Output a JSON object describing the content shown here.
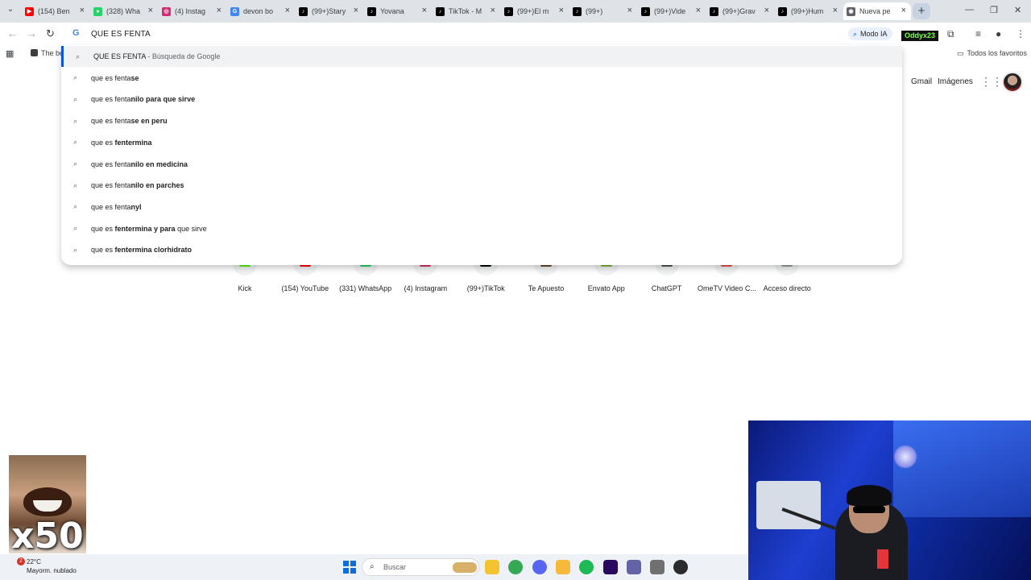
{
  "tabs": [
    {
      "label": "(154) Ben",
      "icon": "youtube-icon",
      "color": "#ff0000",
      "glyph": "▶"
    },
    {
      "label": "(328) Wha",
      "icon": "whatsapp-icon",
      "color": "#25d366",
      "glyph": "●"
    },
    {
      "label": "(4) Instag",
      "icon": "instagram-icon",
      "color": "#d62976",
      "glyph": "◎"
    },
    {
      "label": "devon bo",
      "icon": "google-icon",
      "color": "#4285f4",
      "glyph": "G"
    },
    {
      "label": "(99+)Stary",
      "icon": "tiktok-icon",
      "color": "#000000",
      "glyph": "♪"
    },
    {
      "label": "Yovana",
      "icon": "tiktok-icon",
      "color": "#000000",
      "glyph": "♪"
    },
    {
      "label": "TikTok - M",
      "icon": "tiktok-icon",
      "color": "#000000",
      "glyph": "♪"
    },
    {
      "label": "(99+)El m",
      "icon": "tiktok-icon",
      "color": "#000000",
      "glyph": "♪"
    },
    {
      "label": "(99+)",
      "icon": "tiktok-icon",
      "color": "#000000",
      "glyph": "♪"
    },
    {
      "label": "(99+)Vide",
      "icon": "tiktok-icon",
      "color": "#000000",
      "glyph": "♪"
    },
    {
      "label": "(99+)Grav",
      "icon": "tiktok-icon",
      "color": "#000000",
      "glyph": "♪"
    },
    {
      "label": "(99+)Hum",
      "icon": "tiktok-icon",
      "color": "#000000",
      "glyph": "♪"
    },
    {
      "label": "Nueva pe",
      "icon": "chrome-icon",
      "color": "#5f6368",
      "glyph": "◉",
      "active": true
    }
  ],
  "omnibox": {
    "value": "QUE ES FENTA",
    "modo_ia": "Modo IA",
    "profile_badge": "Oddyx23"
  },
  "bookmarks": {
    "first": "The be",
    "all_favorites": "Todos los favoritos"
  },
  "google_header": {
    "gmail": "Gmail",
    "images": "Imágenes"
  },
  "suggestions": [
    {
      "prefix": "QUE ES FENTA",
      "bold": "",
      "suffix": " - Búsqueda de Google",
      "selected": true
    },
    {
      "prefix": "que es fenta",
      "bold": "se",
      "suffix": ""
    },
    {
      "prefix": "que es fenta",
      "bold": "nilo para que sirve",
      "suffix": ""
    },
    {
      "prefix": "que es fenta",
      "bold": "se en peru",
      "suffix": ""
    },
    {
      "prefix": "que es ",
      "bold": "fentermina",
      "suffix": ""
    },
    {
      "prefix": "que es fenta",
      "bold": "nilo en medicina",
      "suffix": ""
    },
    {
      "prefix": "que es fenta",
      "bold": "nilo en parches",
      "suffix": ""
    },
    {
      "prefix": "que es fenta",
      "bold": "nyl",
      "suffix": ""
    },
    {
      "prefix": "que es ",
      "bold": "fentermina y para",
      "suffix": " que sirve"
    },
    {
      "prefix": "que es ",
      "bold": "fentermina clorhidrato",
      "suffix": ""
    }
  ],
  "shortcuts": [
    {
      "label": "Kick",
      "color": "#53fc18"
    },
    {
      "label": "(154) YouTube",
      "color": "#ff0000"
    },
    {
      "label": "(331) WhatsApp",
      "color": "#25d366"
    },
    {
      "label": "(4) Instagram",
      "color": "#e1306c"
    },
    {
      "label": "(99+)TikTok",
      "color": "#000000"
    },
    {
      "label": "Te Apuesto",
      "color": "#6b4a2b"
    },
    {
      "label": "Envato App",
      "color": "#82b540"
    },
    {
      "label": "ChatGPT",
      "color": "#555555"
    },
    {
      "label": "OmeTV Video C...",
      "color": "#ef5350"
    },
    {
      "label": "Acceso directo",
      "color": "#9e9e9e"
    }
  ],
  "overlay": {
    "meme_label": "x50"
  },
  "taskbar": {
    "weather_badge": "2",
    "temperature": "22°C",
    "weather": "Mayorm. nublado",
    "search_placeholder": "Buscar",
    "apps": [
      {
        "icon": "file-explorer-icon",
        "color": "#f4c430"
      },
      {
        "icon": "chrome-taskbar-icon",
        "color": "#34a853"
      },
      {
        "icon": "discord-icon",
        "color": "#5865f2"
      },
      {
        "icon": "folder-icon",
        "color": "#f6b93b"
      },
      {
        "icon": "spotify-icon",
        "color": "#1db954"
      },
      {
        "icon": "premiere-icon",
        "color": "#2a0a5e"
      },
      {
        "icon": "teams-icon",
        "color": "#6264a7"
      },
      {
        "icon": "settings-icon",
        "color": "#707070"
      },
      {
        "icon": "obs-icon",
        "color": "#2b2b2b"
      }
    ]
  }
}
